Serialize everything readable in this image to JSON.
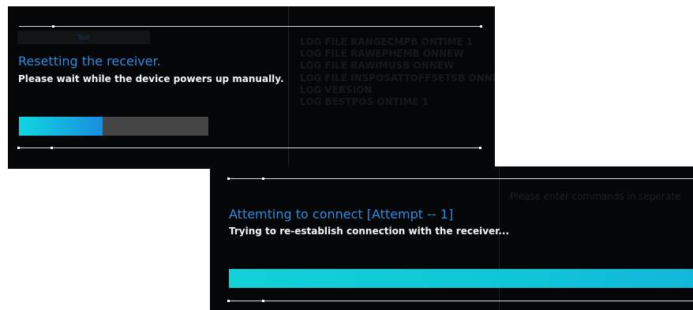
{
  "dialog_reset": {
    "tab_label": "Test",
    "title": "Resetting the receiver.",
    "message": "Please wait while the device powers up manually.",
    "progress_fraction": 0.44,
    "log_lines": [
      "LOG FILE RANGECMPB ONTIME 1",
      "LOG FILE RAWEPHEMB ONNEW",
      "LOG FILE RAWIMUSB ONNEW",
      "LOG FILE INSPOSATTOFFSETSB ONNEW",
      "LOG VERSION",
      "LOG BESTPOS ONTIME 1"
    ],
    "colors": {
      "background": "#050607",
      "title": "#2d8ce0",
      "progress_start": "#10d6e0",
      "progress_end": "#1a8ee0",
      "progress_track": "#454545"
    }
  },
  "dialog_connect": {
    "title": "Attemting to connect [Attempt -- 1]",
    "message": "Trying to re-establish connection with the receiver...",
    "command_hint": "Please enter commands in seperate",
    "progress_fraction": 1.0,
    "colors": {
      "background": "#050607",
      "title": "#2d8ce0",
      "progress": "#12d2d8"
    }
  }
}
